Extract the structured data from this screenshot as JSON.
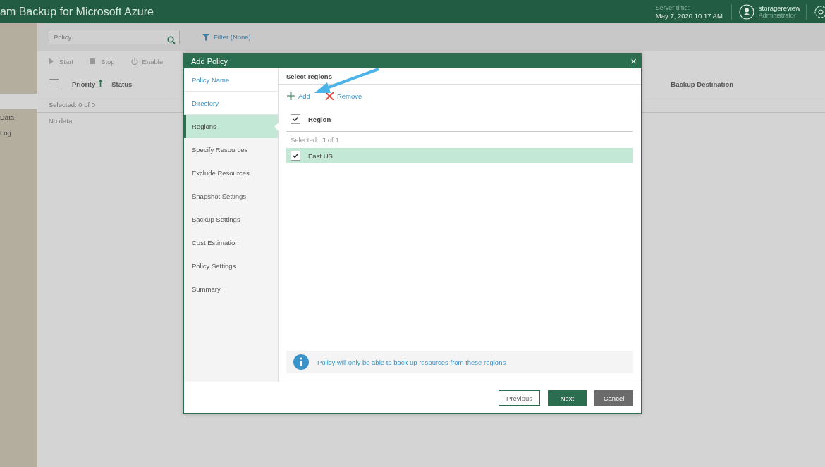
{
  "app": {
    "title": "am Backup for Microsoft Azure",
    "server_time_label": "Server time:",
    "server_time": "May 7, 2020 10:17 AM",
    "user_name": "storagereview",
    "user_role": "Administrator"
  },
  "sidebar": {
    "items": [
      {
        "selected": true
      },
      {
        "label": "Data",
        "selected": false
      },
      {
        "label": "Log",
        "selected": false
      }
    ]
  },
  "toolbar": {
    "search": {
      "placeholder": "Policy"
    },
    "filter": "Filter (None)",
    "actions": [
      {
        "label": "Start",
        "kind": "play"
      },
      {
        "label": "Stop",
        "kind": "stop"
      },
      {
        "label": "Enable",
        "kind": "power"
      }
    ]
  },
  "table": {
    "select_all": {
      "checked": false
    },
    "columns": [
      {
        "label": "Priority",
        "sorted": true
      },
      {
        "label": "Status",
        "sorted": false
      },
      {
        "label": "Backup Destination",
        "sorted": false
      }
    ],
    "selected_label": "Selected:  0 of 0",
    "empty": "No data"
  },
  "dialog": {
    "title": "Add Policy",
    "close": "×",
    "steps": [
      {
        "label": "Policy Name",
        "visited": true,
        "selected": false
      },
      {
        "label": "Directory",
        "visited": true,
        "selected": false
      },
      {
        "label": "Regions",
        "visited": false,
        "selected": true
      },
      {
        "label": "Specify Resources",
        "visited": false,
        "selected": false
      },
      {
        "label": "Exclude Resources",
        "visited": false,
        "selected": false
      },
      {
        "label": "Snapshot Settings",
        "visited": false,
        "selected": false
      },
      {
        "label": "Backup Settings",
        "visited": false,
        "selected": false
      },
      {
        "label": "Cost Estimation",
        "visited": false,
        "selected": false
      },
      {
        "label": "Policy Settings",
        "visited": false,
        "selected": false
      },
      {
        "label": "Summary",
        "visited": false,
        "selected": false
      }
    ],
    "heading": "Select regions",
    "actions": [
      {
        "label": "Add",
        "kind": "add"
      },
      {
        "label": "Remove",
        "kind": "remove"
      }
    ],
    "column": {
      "label": "Region",
      "checked": true
    },
    "selected_label": "Selected:  **1** of 1",
    "rows": [
      {
        "region": "East US",
        "checked": true,
        "selected": true
      }
    ],
    "info": "Policy will only be able to back up resources from these regions",
    "buttons": [
      {
        "label": "Previous",
        "kind": "secondary"
      },
      {
        "label": "Next",
        "kind": "primary"
      },
      {
        "label": "Cancel",
        "kind": "dark"
      }
    ]
  }
}
